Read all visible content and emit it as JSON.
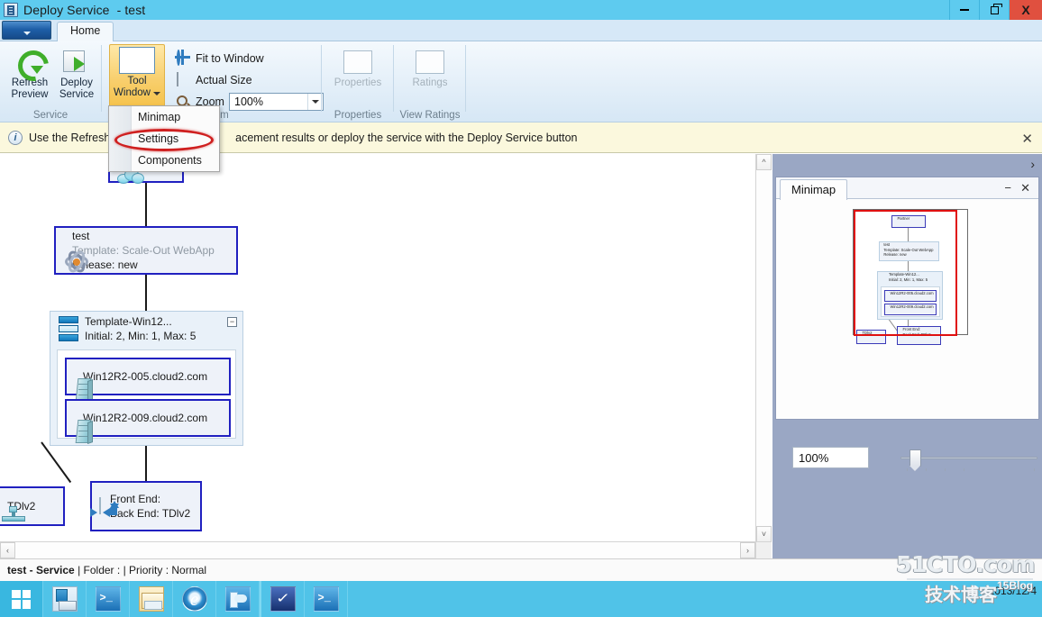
{
  "window": {
    "title": "Deploy Service",
    "subtitle": "- test",
    "icon": "service-icon",
    "buttons": {
      "minimize": "minimize-icon",
      "restore": "restore-icon",
      "close": "X"
    }
  },
  "ribbon": {
    "app_button": "app-menu-button",
    "tabs": [
      {
        "label": "Home",
        "selected": true
      }
    ],
    "groups": [
      {
        "label": "Service",
        "buttons": [
          {
            "label_line1": "Refresh",
            "label_line2": "Preview",
            "icon": "refresh-icon",
            "enabled": true
          },
          {
            "label_line1": "Deploy",
            "label_line2": "Service",
            "icon": "deploy-icon",
            "enabled": true
          }
        ]
      },
      {
        "label": "Zoom",
        "big_button": {
          "label_line1": "Tool",
          "label_line2": "Window",
          "icon": "tool-window-icon",
          "active": true,
          "has_caret": true
        },
        "items": [
          {
            "label": "Fit to Window",
            "icon": "fit-to-window-icon"
          },
          {
            "label": "Actual Size",
            "icon": "actual-size-icon"
          },
          {
            "label": "Zoom",
            "icon": "zoom-icon"
          }
        ],
        "zoom_value": "100%"
      },
      {
        "label": "Properties",
        "button": {
          "label": "Properties",
          "icon": "properties-icon",
          "enabled": false
        }
      },
      {
        "label": "View Ratings",
        "button": {
          "label": "Ratings",
          "icon": "ratings-icon",
          "enabled": false
        }
      }
    ]
  },
  "menu": {
    "items": [
      {
        "label": "Minimap"
      },
      {
        "label": "Settings",
        "highlighted": true
      },
      {
        "label": "Components"
      }
    ],
    "annotation_color": "#cf2020"
  },
  "infobar": {
    "icon": "info-icon",
    "text_left": "Use the Refresh P",
    "text_right": "acement results or deploy the service with the Deploy Service button",
    "close": "✕"
  },
  "canvas": {
    "nodes": [
      {
        "id": "partner",
        "label": "Partner",
        "icon": "cloud-icon"
      },
      {
        "id": "service",
        "title": "test",
        "line2": "Template: Scale-Out WebApp",
        "line3": "Release: new",
        "icon": "service-atom-icon"
      },
      {
        "id": "tier",
        "title": "Template-Win12...",
        "line2": "Initial: 2, Min: 1, Max: 5",
        "icon": "tier-icon",
        "collapse": "−"
      },
      {
        "id": "vm1",
        "label": "Win12R2-005.cloud2.com",
        "icon": "vm-icon"
      },
      {
        "id": "vm2",
        "label": "Win12R2-009.cloud2.com",
        "icon": "vm-icon"
      },
      {
        "id": "lb",
        "label": "TDlv2",
        "icon": "load-balancer-icon"
      },
      {
        "id": "frontend",
        "line1": "Front End:",
        "line2": "Back End: TDlv2",
        "icon": "front-back-end-icon"
      }
    ]
  },
  "dock": {
    "expand": "›",
    "panel": {
      "tab": "Minimap",
      "minimize": "−",
      "close": "✕",
      "zoom_value": "100%"
    }
  },
  "statusbar": {
    "name": "test - Service",
    "separator1": "|",
    "folder": "Folder :",
    "separator2": "|",
    "priority": "Priority : Normal",
    "caret": "▲"
  },
  "taskbar": {
    "start": "windows-start-icon",
    "items": [
      {
        "icon": "server-manager-icon"
      },
      {
        "icon": "powershell-icon"
      },
      {
        "icon": "file-explorer-icon"
      },
      {
        "icon": "internet-explorer-icon"
      },
      {
        "icon": "vmm-console-icon"
      },
      {
        "icon": "performance-monitor-icon"
      },
      {
        "icon": "powershell-ise-icon"
      }
    ],
    "clock_date": "2013/12/4"
  },
  "watermark": {
    "main": "51CTO.com",
    "sub": "技术博客",
    "blog": "15Blog"
  },
  "colors": {
    "titlebar": "#5ecbef",
    "taskbar": "#50c3e8",
    "ribbon_active": "#f5c24a",
    "infobar": "#fbf8dd",
    "node_border": "#2020c0",
    "annotation": "#cf2020",
    "viewport": "#e01010"
  }
}
